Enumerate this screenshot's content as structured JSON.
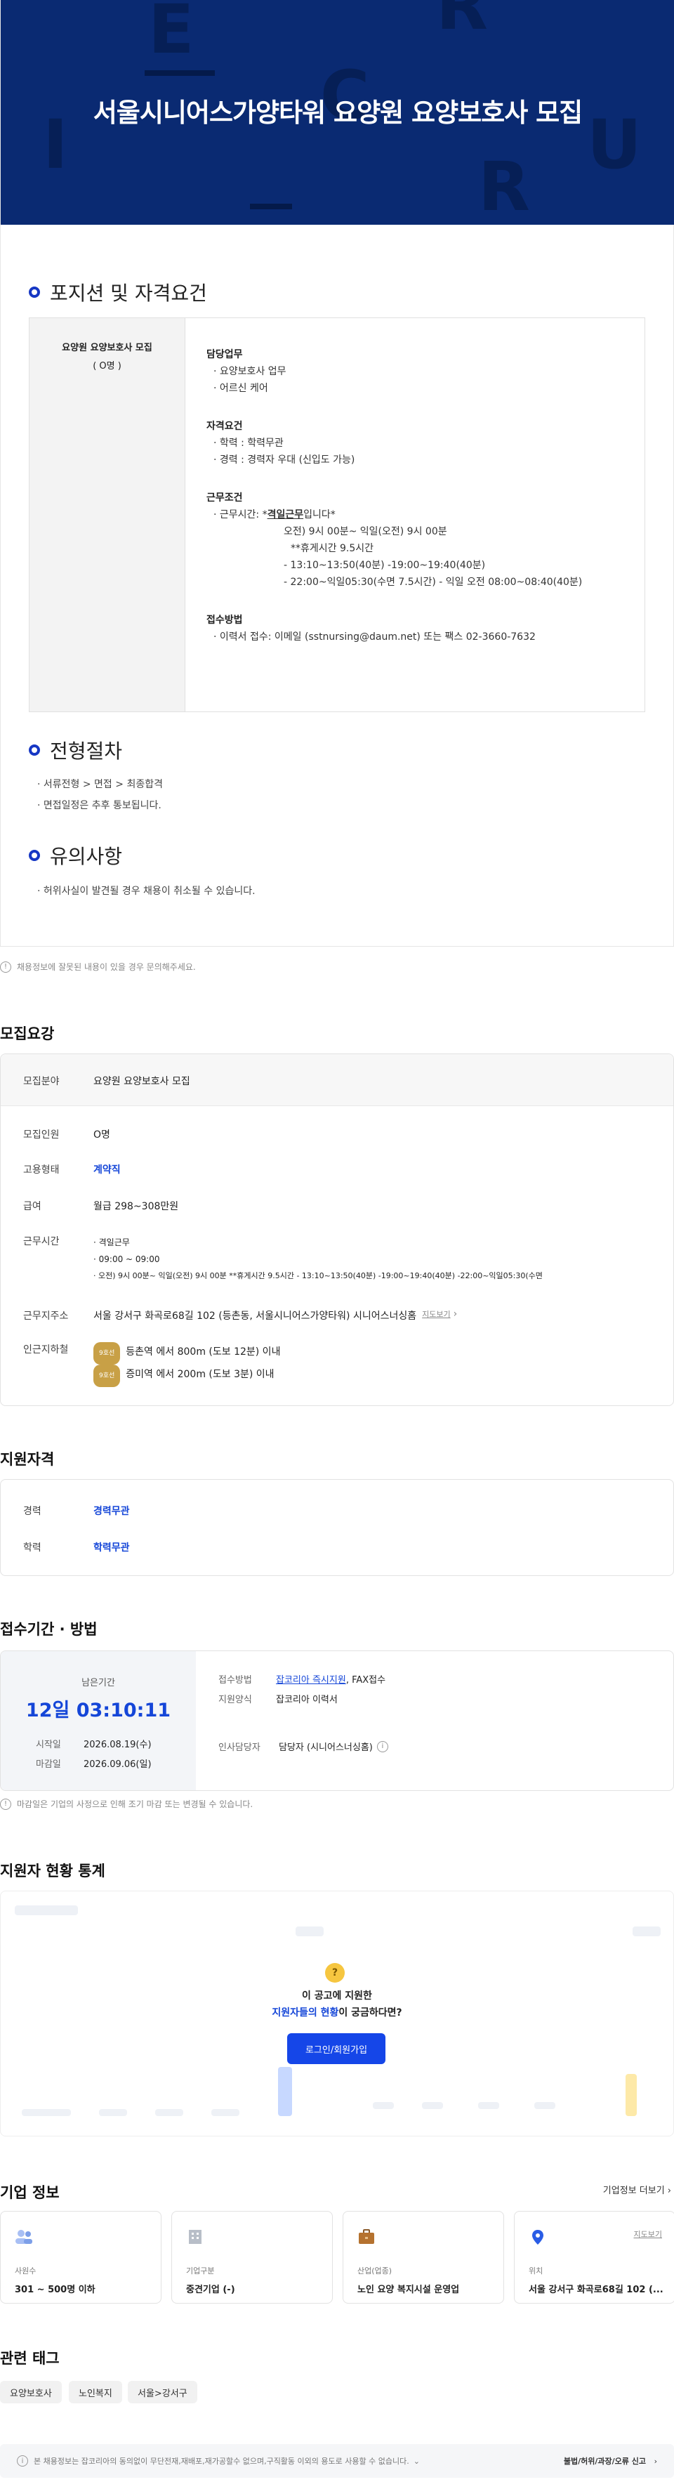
{
  "banner": {
    "title": "서울시니어스가양타워 요양원 요양보호사 모집",
    "deco": [
      "E",
      "R",
      "C",
      "I",
      "U",
      "R"
    ]
  },
  "position": {
    "section_title": "포지션 및 자격요건",
    "left_title": "요양원 요양보호사 모집",
    "left_count": "( O명 )",
    "duty_h": "담당업무",
    "duty": [
      "요양보호사 업무",
      "어르신 케어"
    ],
    "qual_h": "자격요건",
    "qual": [
      "학력 : 학력무관",
      "경력 : 경력자 우대 (신입도 가능)"
    ],
    "work_h": "근무조건",
    "work_l1_pre": "근무시간: *",
    "work_l1_bold": "격일근무",
    "work_l1_post": "입니다*",
    "work_lines": [
      "오전) 9시 00분~ 익일(오전) 9시 00분",
      "**휴게시간 9.5시간"
    ],
    "work_lines2": [
      "- 13:10~13:50(40분) -19:00~19:40(40분)",
      "- 22:00~익일05:30(수면 7.5시간)  - 익일 오전 08:00~08:40(40분)"
    ],
    "apply_h": "접수방법",
    "apply": "이력서 접수: 이메일 (sstnursing@daum.net) 또는 팩스 02-3660-7632"
  },
  "process": {
    "title": "전형절차",
    "lines": [
      "서류전형 > 면접 > 최종합격",
      "면접일정은 추후 통보됩니다."
    ]
  },
  "caution": {
    "title": "유의사항",
    "lines": [
      "허위사실이 발견될 경우 채용이 취소될 수 있습니다."
    ]
  },
  "report": "채용정보에 잘못된 내용이 있을 경우 문의해주세요.",
  "summary": {
    "title": "모집요강",
    "field_k": "모집분야",
    "field_v": "요양원 요양보호사 모집",
    "count_k": "모집인원",
    "count_v": "O명",
    "type_k": "고용형태",
    "type_v": "계약직",
    "pay_k": "급여",
    "pay_v": "월급 298~308만원",
    "time_k": "근무시간",
    "time_v": [
      "격일근무",
      "09:00 ~ 09:00",
      "오전) 9시 00분~ 익일(오전) 9시 00분 **휴게시간 9.5시간 - 13:10~13:50(40분) -19:00~19:40(40분) -22:00~익일05:30(수면"
    ],
    "addr_k": "근무지주소",
    "addr_v": "서울 강서구 화곡로68길 102 (등촌동, 서울시니어스가양타워) 시니어스너싱홈",
    "map": "지도보기",
    "subway_k": "인근지하철",
    "subway": [
      {
        "tag": "9호선",
        "text": "등촌역 에서 800m (도보 12분) 이내"
      },
      {
        "tag": "9호선",
        "text": "증미역 에서 200m (도보 3분) 이내"
      }
    ]
  },
  "qualification": {
    "title": "지원자격",
    "career_k": "경력",
    "career_v": "경력무관",
    "edu_k": "학력",
    "edu_v": "학력무관"
  },
  "deadline": {
    "title": "접수기간 · 방법",
    "remain_label": "남은기간",
    "remain": "12일 03:10:11",
    "start_k": "시작일",
    "start_v": "2026.08.19(수)",
    "end_k": "마감일",
    "end_v": "2026.09.06(일)",
    "method_k": "접수방법",
    "method_link": "잡코리아 즉시지원",
    "method_rest": ", FAX접수",
    "form_k": "지원양식",
    "form_v": "잡코리아 이력서",
    "hr_k": "인사담당자",
    "hr_v": "담당자 (시니어스너싱홈)",
    "note": "마감일은 기업의 사정으로 인해 조기 마감 또는 변경될 수 있습니다."
  },
  "stats": {
    "title": "지원자 현황 통계",
    "q1": "이 공고에 지원한",
    "q2_blue": "지원자들의 현황",
    "q2_rest": "이 궁금하다면?",
    "button": "로그인/회원가입"
  },
  "company": {
    "title": "기업 정보",
    "more": "기업정보 더보기",
    "cards": [
      {
        "label": "사원수",
        "value": "301 ~ 500명 이하",
        "icon": "people-icon"
      },
      {
        "label": "기업구분",
        "value": "중견기업 (-)",
        "icon": "building-icon"
      },
      {
        "label": "산업(업종)",
        "value": "노인 요양 복지시설 운영업",
        "icon": "briefcase-icon"
      },
      {
        "label": "위치",
        "value": "서울 강서구 화곡로68길 102 (...",
        "icon": "pin-icon",
        "link": "지도보기"
      }
    ]
  },
  "tags": {
    "title": "관련 태그",
    "items": [
      "요양보호사",
      "노인복지",
      "서울>강서구"
    ]
  },
  "footer": {
    "text": "본 채용정보는 잡코리아의 동의없이 무단전재,재배포,재가공할수 없으며,구직활동 이외의 용도로 사용할 수 없습니다.",
    "report": "불법/허위/과장/오류 신고"
  },
  "colors": {
    "banner": "#0a2a72",
    "accent": "#1546d8",
    "button": "#1546e8",
    "tag": "#c8a046"
  }
}
